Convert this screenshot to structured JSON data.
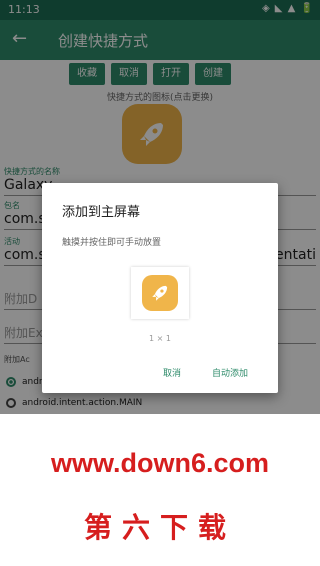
{
  "status_bar": {
    "time": "11:13",
    "icons": "◈ ◣ ▲ 🔋"
  },
  "app_bar": {
    "back_icon": "arrow-left-icon",
    "title": "创建快捷方式"
  },
  "toolbar": {
    "buttons": [
      "收藏",
      "取消",
      "打开",
      "创建"
    ]
  },
  "icon_section": {
    "hint": "快捷方式的图标(点击更换)",
    "icon": "rocket-icon",
    "icon_color": "#f0b54a"
  },
  "fields": {
    "name_label": "快捷方式的名称",
    "name_value": "Galaxy",
    "package_label": "包名",
    "package_value": "com.sa",
    "activity_label": "活动",
    "activity_value": "com.sa",
    "activity_value_tail": "sentati",
    "data_hint": "附加D",
    "extra_hint": "附加Ex",
    "action_label": "附加Ac"
  },
  "radio_options": [
    "andro",
    "android.intent.action.MAIN"
  ],
  "dialog": {
    "title": "添加到主屏幕",
    "message": "触摸并按住即可手动放置",
    "size_label": "1 × 1",
    "cancel_label": "取消",
    "auto_add_label": "自动添加"
  },
  "watermark": {
    "url": "www.down6.com",
    "name": "第六下载"
  },
  "colors": {
    "primary": "#2e8b6a",
    "status_bar": "#1d6e54",
    "accent_red": "#d61e1e"
  }
}
